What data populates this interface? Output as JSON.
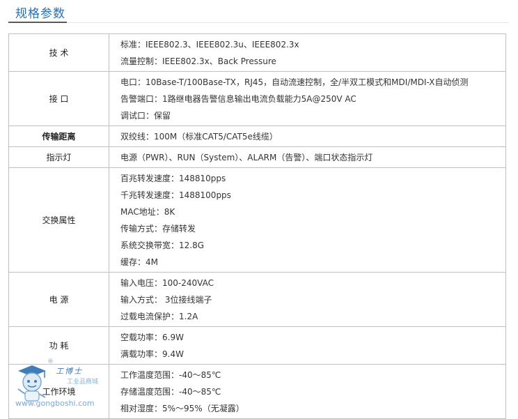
{
  "page": {
    "title": "规格参数"
  },
  "spec_rows": [
    {
      "key": "技 术",
      "bold": false,
      "lines": [
        "标准：IEEE802.3、IEEE802.3u、IEEE802.3x",
        "流量控制：IEEE802.3x、Back Pressure"
      ]
    },
    {
      "key": "接 口",
      "bold": false,
      "lines": [
        "电口：10Base-T/100Base-TX，RJ45，自动流速控制，全/半双工模式和MDI/MDI-X自动侦测",
        "告警端口：1路继电器告警信息输出电流负载能力5A@250V AC",
        "调试口：保留"
      ]
    },
    {
      "key": "传输距离",
      "bold": true,
      "lines": [
        "双绞线：100M（标准CAT5/CAT5e线缆）"
      ]
    },
    {
      "key": "指示灯",
      "bold": false,
      "lines": [
        "电源（PWR）、RUN（System）、ALARM（告警）、端口状态指示灯"
      ]
    },
    {
      "key": "交换属性",
      "bold": false,
      "lines": [
        "百兆转发速度：148810pps",
        "千兆转发速度：1488100pps",
        "MAC地址：8K",
        "传输方式：存储转发",
        "系统交换带宽：12.8G",
        "缓存：4M"
      ]
    },
    {
      "key": "电 源",
      "bold": false,
      "lines": [
        "输入电压：100-240VAC",
        "输入方式： 3位接线端子",
        "过载电流保护：1.2A"
      ]
    },
    {
      "key": "功 耗",
      "bold": false,
      "lines": [
        "空载功率：6.9W",
        "满载功率：9.4W"
      ]
    },
    {
      "key": "工作环境",
      "bold": false,
      "lines": [
        "工作温度范围：-40～85℃",
        "存储温度范围：-40～85℃",
        "相对湿度：5%～95%（无凝露）"
      ]
    }
  ],
  "watermark": {
    "brand": "工博士",
    "subtitle": "工业品商城",
    "url": "www.gongboshi.com",
    "reg": "®"
  }
}
